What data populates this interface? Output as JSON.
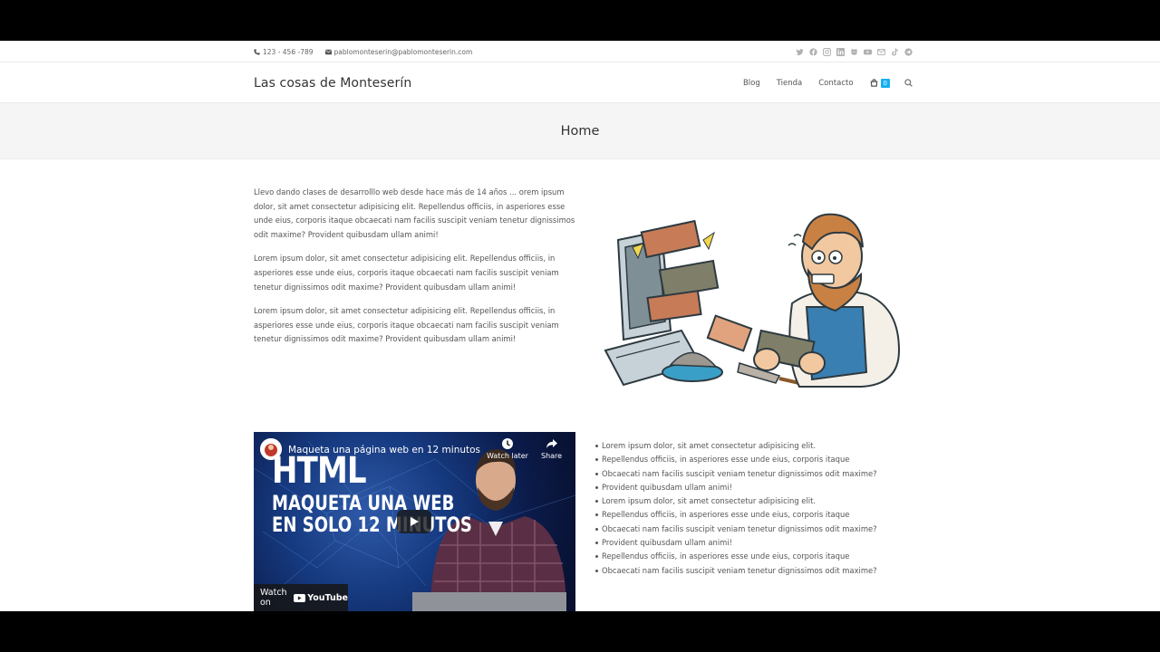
{
  "topbar": {
    "phone": "123 - 456 -789",
    "email": "pablomonteserin@pablomonteserin.com",
    "social_icons": [
      "twitter-icon",
      "facebook-icon",
      "instagram-icon",
      "linkedin-icon",
      "github-icon",
      "youtube-icon",
      "mail-icon",
      "tiktok-icon",
      "telegram-icon"
    ]
  },
  "header": {
    "site_title": "Las cosas de Monteserín",
    "nav": [
      "Blog",
      "Tienda",
      "Contacto"
    ],
    "cart_count": "0"
  },
  "page_title": "Home",
  "intro": {
    "paragraphs": [
      "Llevo dando clases de desarrolllo web desde hace más de 14 años ... orem ipsum dolor, sit amet consectetur adipisicing elit. Repellendus officiis, in asperiores esse unde eius, corporis itaque obcaecati nam facilis suscipit veniam tenetur dignissimos odit maxime? Provident quibusdam ullam animi!",
      "Lorem ipsum dolor, sit amet consectetur adipisicing elit. Repellendus officiis, in asperiores esse unde eius, corporis itaque obcaecati nam facilis suscipit veniam tenetur dignissimos odit maxime? Provident quibusdam ullam animi!",
      "Lorem ipsum dolor, sit amet consectetur adipisicing elit. Repellendus officiis, in asperiores esse unde eius, corporis itaque obcaecati nam facilis suscipit veniam tenetur dignissimos odit maxime? Provident quibusdam ullam animi!"
    ]
  },
  "video": {
    "title": "Maqueta una página web en 12 minutos",
    "thumb_line1": "HTML",
    "thumb_line2": "MAQUETA UNA WEB",
    "thumb_line3": "EN SOLO 12 MINUTOS",
    "watch_later": "Watch later",
    "share": "Share",
    "watch_on": "Watch on",
    "youtube": "YouTube"
  },
  "bullets": [
    "Lorem ipsum dolor, sit amet consectetur adipisicing elit.",
    "Repellendus officiis, in asperiores esse unde eius, corporis itaque",
    "Obcaecati nam facilis suscipit veniam tenetur dignissimos odit maxime?",
    "Provident quibusdam ullam animi!",
    "Lorem ipsum dolor, sit amet consectetur adipisicing elit.",
    "Repellendus officiis, in asperiores esse unde eius, corporis itaque",
    "Obcaecati nam facilis suscipit veniam tenetur dignissimos odit maxime?",
    "Provident quibusdam ullam animi!",
    "Repellendus officiis, in asperiores esse unde eius, corporis itaque",
    "Obcaecati nam facilis suscipit veniam tenetur dignissimos odit maxime?"
  ],
  "colors": {
    "accent": "#13aff0",
    "band": "#f5f5f5",
    "text": "#555555"
  }
}
